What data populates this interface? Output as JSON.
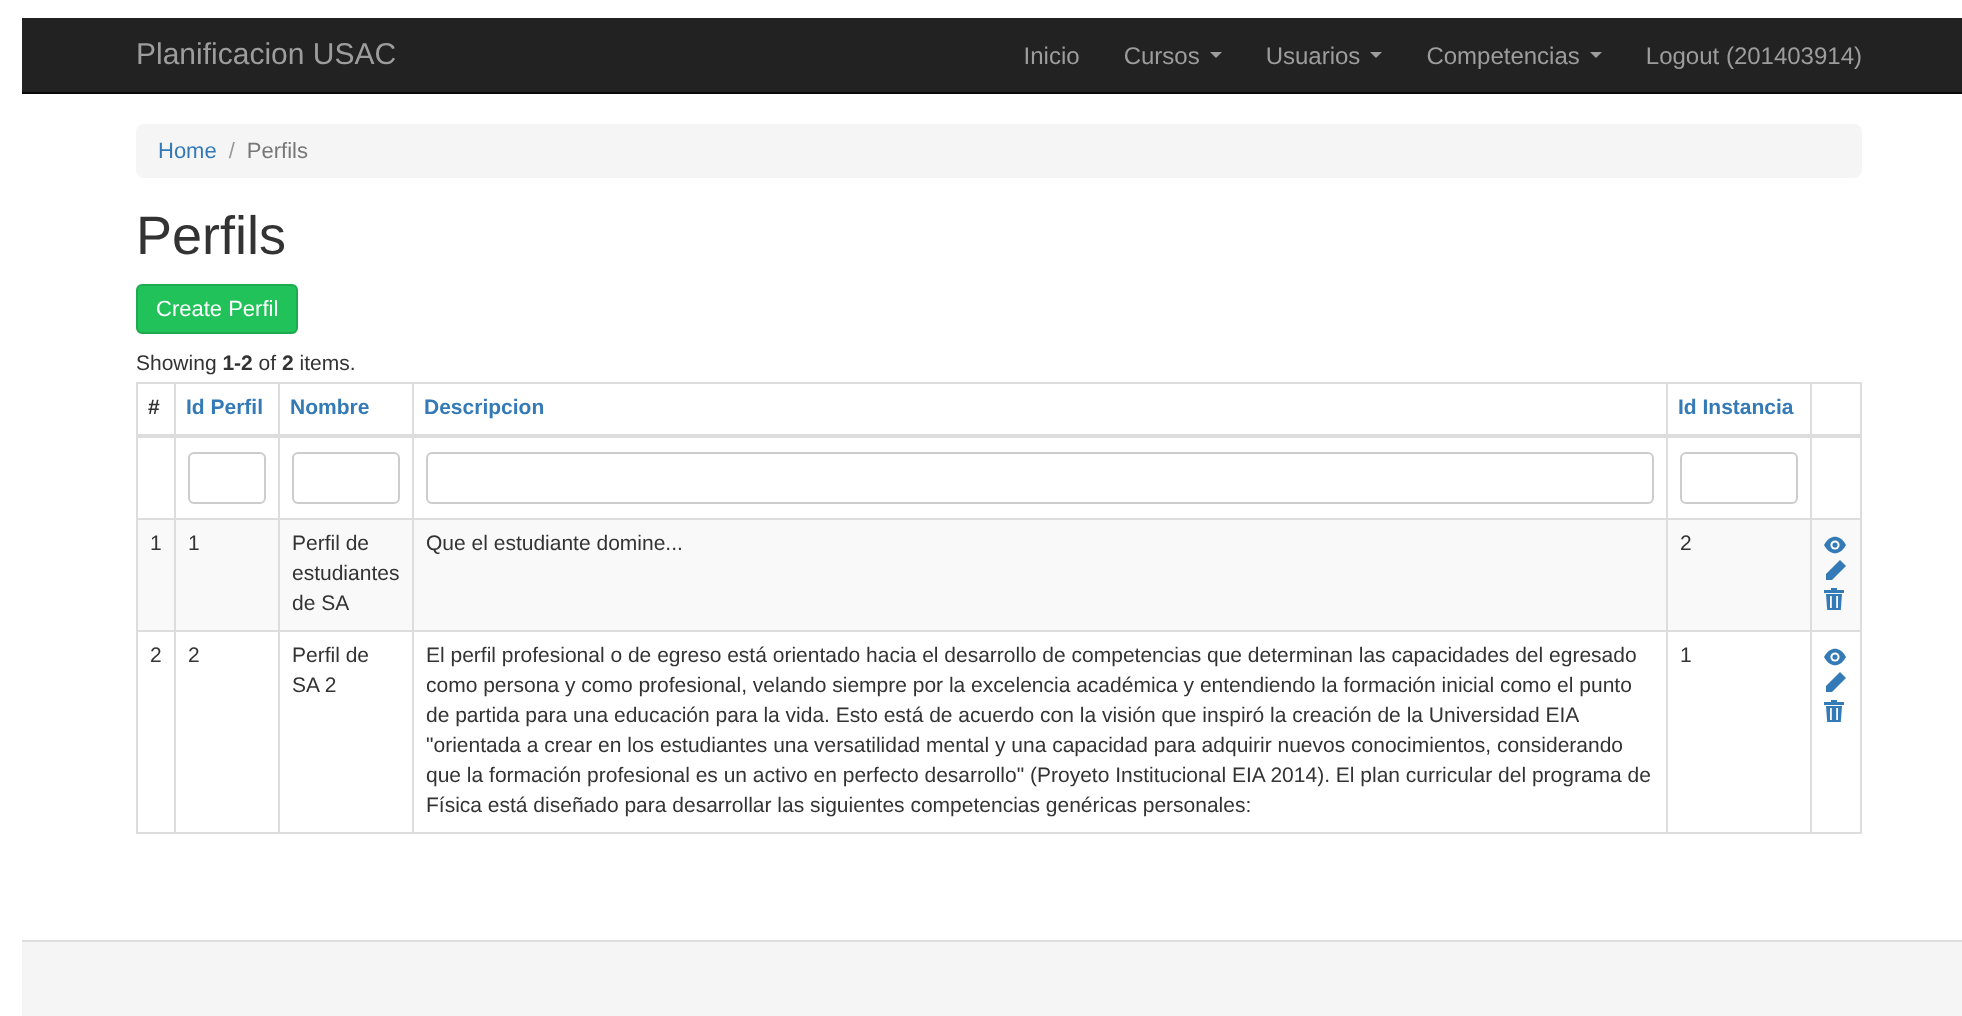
{
  "navbar": {
    "brand": "Planificacion USAC",
    "items": [
      {
        "label": "Inicio",
        "dropdown": false
      },
      {
        "label": "Cursos",
        "dropdown": true
      },
      {
        "label": "Usuarios",
        "dropdown": true
      },
      {
        "label": "Competencias",
        "dropdown": true
      },
      {
        "label": "Logout (201403914)",
        "dropdown": false
      }
    ]
  },
  "breadcrumb": [
    {
      "label": "Home",
      "link": true
    },
    {
      "label": "Perfils",
      "link": false
    }
  ],
  "breadcrumb_separator": "/",
  "title": "Perfils",
  "create_button": "Create Perfil",
  "summary": "Showing **1-2** of **2** items.",
  "table": {
    "columns": [
      {
        "label": "#",
        "sortable": false,
        "filter": false
      },
      {
        "label": "Id Perfil",
        "sortable": true,
        "filter": true
      },
      {
        "label": "Nombre",
        "sortable": true,
        "filter": true
      },
      {
        "label": "Descripcion",
        "sortable": true,
        "filter": true
      },
      {
        "label": "Id Instancia",
        "sortable": true,
        "filter": true
      }
    ],
    "rows": [
      {
        "cells": [
          "1",
          "1",
          "Perfil de estudiantes de SA",
          "Que el estudiante domine...",
          "2"
        ]
      },
      {
        "cells": [
          "2",
          "2",
          "Perfil de SA 2",
          "El perfil profesional o de egreso está orientado hacia el desarrollo de competencias que determinan las capacidades del egresado como persona y como profesional, velando siempre por la excelencia académica y entendiendo la formación inicial como el punto de partida para una educación para la vida. Esto está de acuerdo con la visión que inspiró la creación de la Universidad EIA \"orientada a crear en los estudiantes una versatilidad mental y una capacidad para adquirir nuevos conocimientos, considerando que la formación profesional es un activo en perfecto desarrollo\" (Proyeto Institucional EIA 2014). El plan curricular del programa de Física está diseñado para desarrollar las siguientes competencias genéricas personales:",
          "1"
        ]
      }
    ]
  }
}
